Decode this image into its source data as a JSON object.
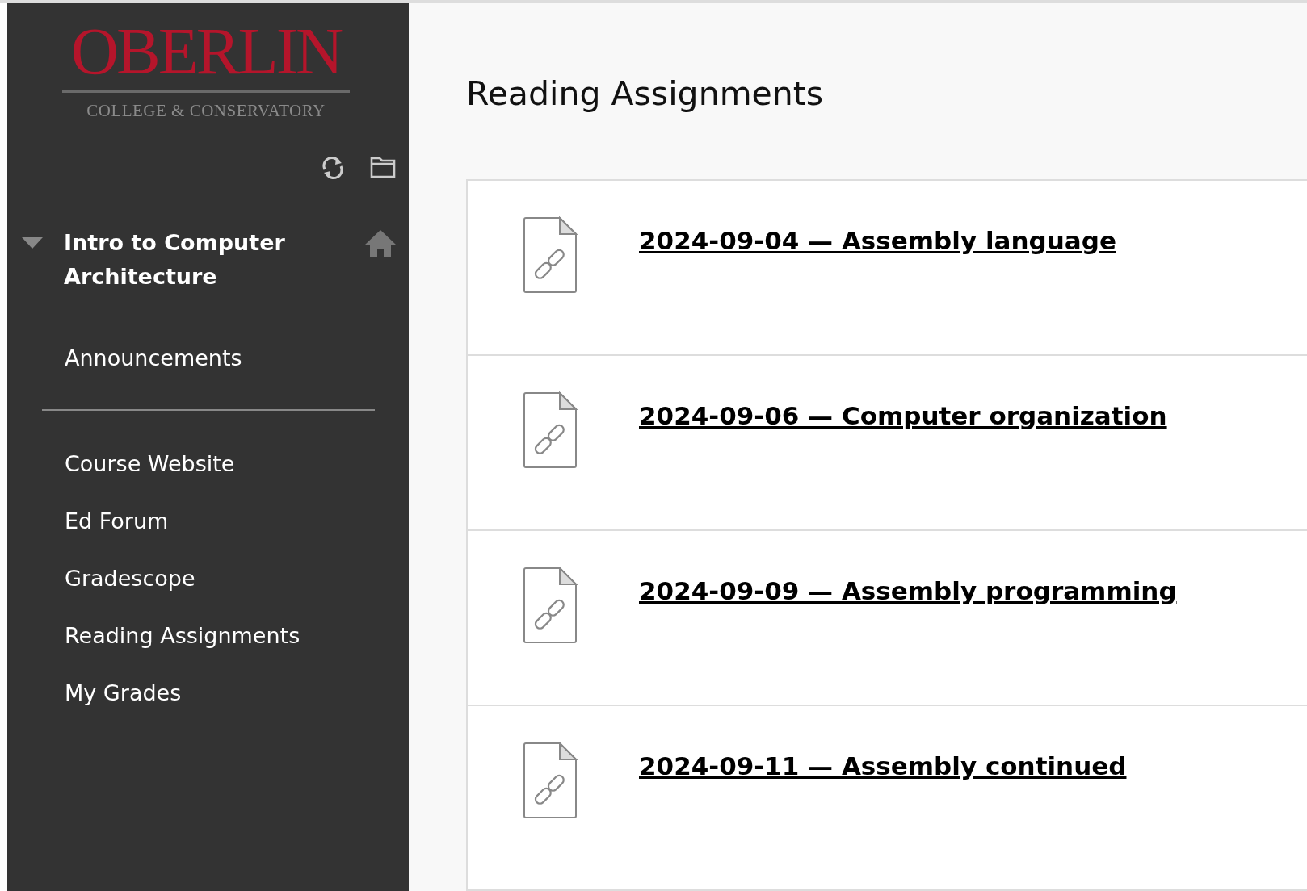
{
  "logo": {
    "name": "OBERLIN",
    "subtitle": "COLLEGE & CONSERVATORY"
  },
  "course": {
    "title": "Intro to Computer Architecture",
    "expanded": true
  },
  "menu_groups": [
    [
      "Announcements"
    ],
    [
      "Course Website",
      "Ed Forum",
      "Gradescope",
      "Reading Assignments",
      "My Grades"
    ]
  ],
  "page_title": "Reading Assignments",
  "items": [
    {
      "kind": "link",
      "title": "2024-09-04 — Assembly language"
    },
    {
      "kind": "link",
      "title": "2024-09-06 — Computer organization"
    },
    {
      "kind": "link",
      "title": "2024-09-09 — Assembly programming"
    },
    {
      "kind": "link",
      "title": "2024-09-11 — Assembly continued"
    }
  ]
}
